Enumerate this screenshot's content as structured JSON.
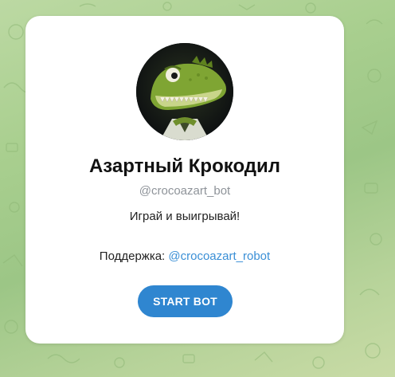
{
  "bot": {
    "name": "Азартный Крокодил",
    "username": "@crocoazart_bot",
    "description": "Играй и выигрывай!",
    "support_label": "Поддержка:",
    "support_link": "@crocoazart_robot",
    "avatar_icon": "crocodile-avatar-icon"
  },
  "actions": {
    "start_label": "START BOT"
  },
  "colors": {
    "accent": "#2f86d0",
    "link": "#3a8fd6",
    "background": "#a9cf8f"
  }
}
